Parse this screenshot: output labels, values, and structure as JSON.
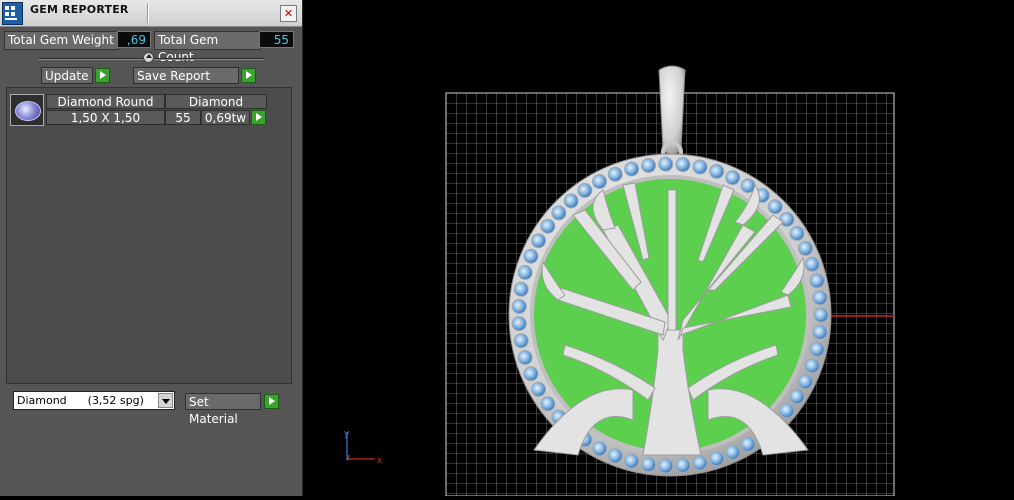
{
  "panel": {
    "title": "GEM REPORTER",
    "close_glyph": "✕",
    "total_gem_weight_label": "Total Gem Weight",
    "total_gem_weight_value": ",69",
    "total_gem_count_label": "Total Gem Count",
    "total_gem_count_value": "55",
    "update_label": "Update",
    "save_report_label": "Save Report",
    "gems": [
      {
        "shape": "Diamond Round",
        "type": "Diamond",
        "size": "1,50 X 1,50",
        "count": "55",
        "weight": "0,69tw"
      }
    ],
    "material_select": "Diamond      (3,52 spg)",
    "set_material_label": "Set Material",
    "icons": [
      "gem-reporter-app-icon",
      "close-icon",
      "play-icon",
      "gem-thumbnail-icon",
      "chevron-down-icon"
    ]
  },
  "viewport": {
    "axis_y_label": "y",
    "axis_z_label": "z",
    "axis_x_label": "x",
    "colors": {
      "background": "#000000",
      "grid": "#bdbdbd",
      "enamel": "#5ccf4e",
      "metal": "#d9d9d9",
      "gem": "#7fb2e0",
      "axis_x": "#cc2020",
      "axis_y": "#3a7bd5"
    }
  }
}
